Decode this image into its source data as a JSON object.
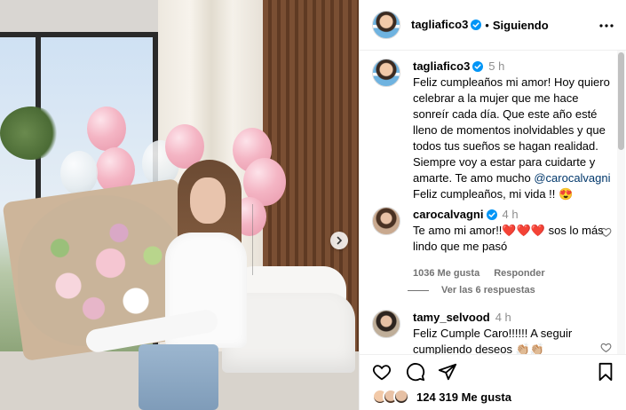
{
  "header": {
    "username": "tagliafico3",
    "separator": "•",
    "follow_status": "Siguiendo"
  },
  "caption": {
    "username": "tagliafico3",
    "time": "5 h",
    "text_before": "Feliz cumpleaños mi amor! Hoy quiero celebrar a la mujer que me hace sonreír cada día. Que este año esté lleno de momentos inolvidables y que todos tus sueños se hagan realidad. Siempre voy a estar para cuidarte y amarte. Te amo mucho ",
    "mention": "@carocalvagni",
    "text_after": "Feliz cumpleaños, mi vida !! 😍"
  },
  "comments": [
    {
      "username": "carocalvagni",
      "time": "4 h",
      "text": "Te amo mi amor!!❤️❤️❤️ sos lo más lindo que me pasó",
      "likes": "1036 Me gusta",
      "reply": "Responder"
    },
    {
      "username": "tamy_selvood",
      "time": "4 h",
      "text": "Feliz Cumple Caro!!!!!! A seguir cumpliendo deseos 👏🏼👏🏼"
    }
  ],
  "replies_label": "Ver las 6 respuestas",
  "likes_count": "124 319 Me gusta",
  "icons": {
    "verified": "verified-badge-icon",
    "more": "more-options-icon",
    "like": "heart-icon",
    "comment": "comment-icon",
    "share": "paper-plane-icon",
    "save": "bookmark-icon",
    "next": "chevron-right-icon"
  },
  "colors": {
    "verified": "#0095f6",
    "mention": "#00376b",
    "muted": "#8e8e8e"
  }
}
